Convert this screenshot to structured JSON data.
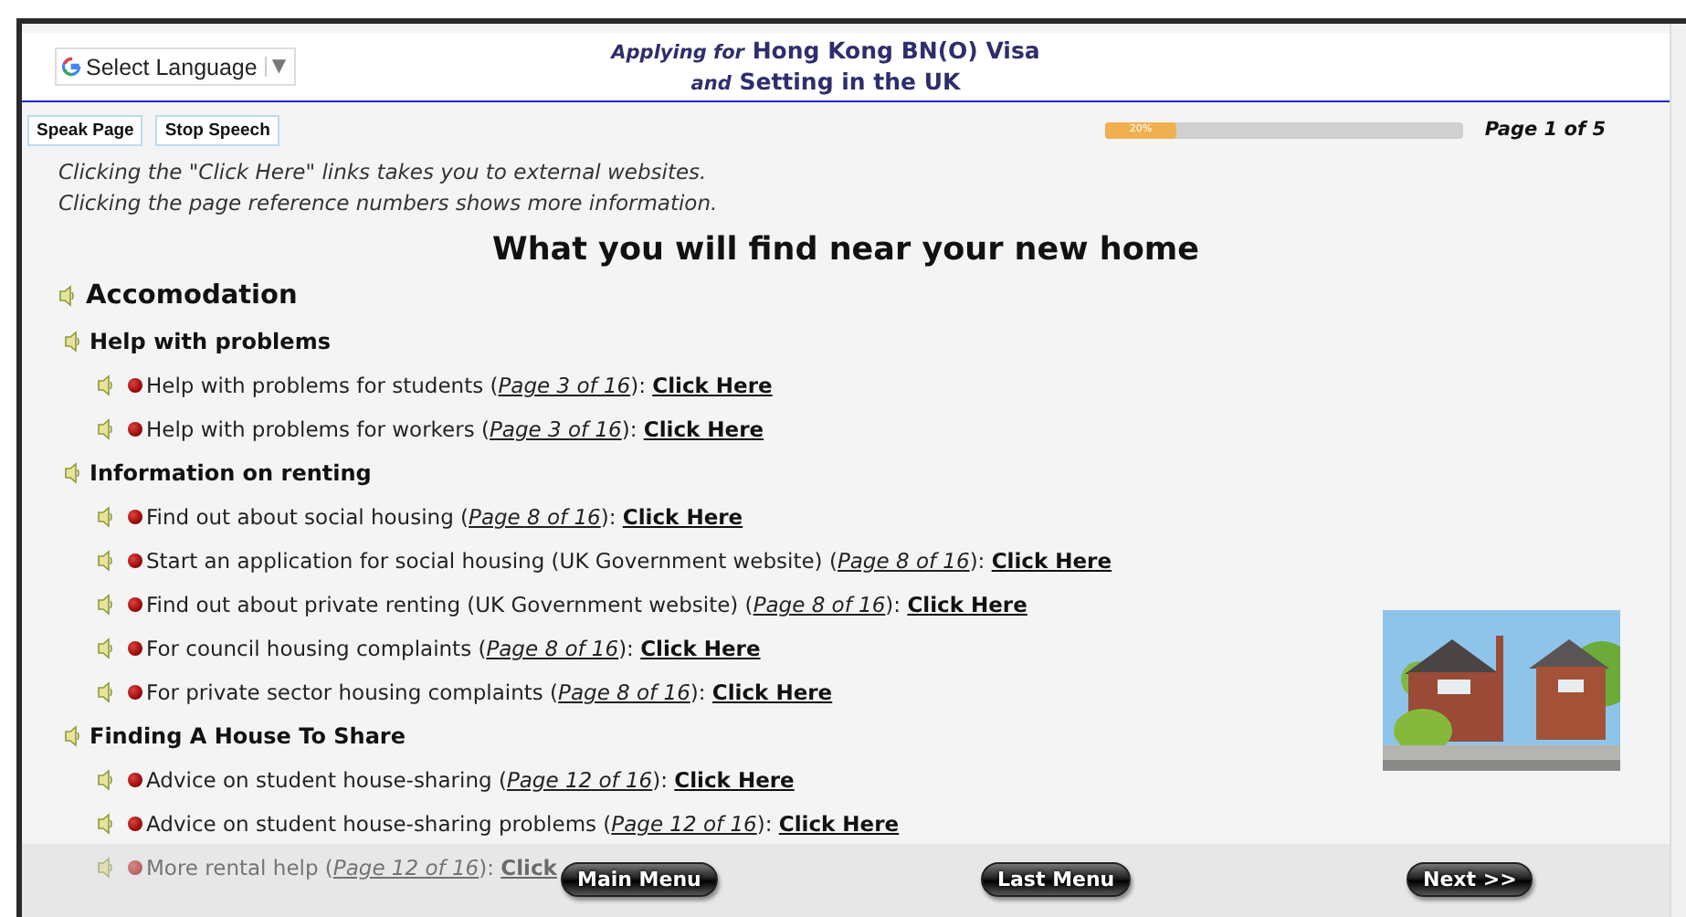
{
  "header": {
    "language_select": {
      "label": "Select Language",
      "arrow": "▼"
    },
    "title_line_1": {
      "prefix": "Applying for",
      "main": "Hong Kong BN(O) Visa"
    },
    "title_line_2": {
      "prefix": "and",
      "main": "Setting in the UK"
    }
  },
  "toolbar": {
    "buttons": [
      "Speak Page",
      "Stop Speech"
    ],
    "progress": {
      "level": 0.2,
      "label": "20%"
    },
    "page_indicator": "Page 1 of 5"
  },
  "instructions": [
    "Clicking the \"Click Here\" *links takes you to external websites.*",
    "Clicking the page reference numbers shows more information."
  ],
  "heading": "What you will find near your new home",
  "section": {
    "title": "Accomodation",
    "groups": [
      {
        "title": "Help with problems",
        "items": [
          {
            "text": "Help with problems for students (",
            "page": "Page 3 of 16",
            "suffix": "):",
            "link": "Click Here"
          },
          {
            "text": "Help with problems for workers (",
            "page": "Page 3 of 16",
            "suffix": "):",
            "link": "Click Here"
          }
        ]
      },
      {
        "title": "Information on renting",
        "items": [
          {
            "text": "Find out about social housing (",
            "page": "Page 8 of 16",
            "suffix": "):",
            "link": "Click Here"
          },
          {
            "text": "Start an application for social housing (UK Government website) (",
            "page": "Page 8 of 16",
            "suffix": "):",
            "link": "Click Here"
          },
          {
            "text": "Find out about private renting (UK Government website) (",
            "page": "Page 8 of 16",
            "suffix": "):",
            "link": "Click Here"
          },
          {
            "text": "For council housing complaints (",
            "page": "Page 8 of 16",
            "suffix": "):",
            "link": "Click Here"
          },
          {
            "text": "For private sector housing complaints (",
            "page": "Page 8 of 16",
            "suffix": "):",
            "link": "Click Here"
          }
        ]
      },
      {
        "title": "Finding A House To Share",
        "items": [
          {
            "text": "Advice on student house-sharing (",
            "page": "Page 12 of 16",
            "suffix": "):",
            "link": "Click Here"
          },
          {
            "text": "Advice on student house-sharing problems (",
            "page": "Page 12 of 16",
            "suffix": "):",
            "link": "Click Here"
          },
          {
            "text": "More rental help (",
            "page": "Page 12 of 16",
            "suffix": "):",
            "link": "Click"
          }
        ]
      }
    ]
  },
  "image": {
    "kind": "picture"
  },
  "footer": {
    "buttons": [
      "Main Menu",
      "Last Menu",
      "Next >>"
    ]
  }
}
